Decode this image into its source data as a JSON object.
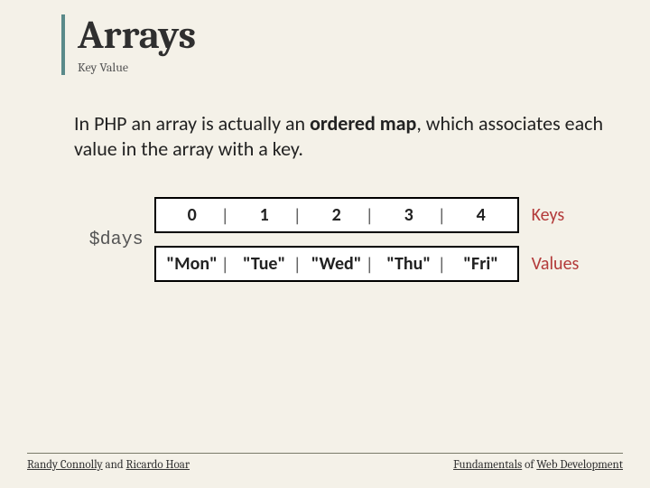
{
  "title": "Arrays",
  "subtitle": "Key Value",
  "body": {
    "pre": "In PHP an array is actually an ",
    "bold": "ordered map",
    "post": ", which associates each value in the array with a key."
  },
  "diagram": {
    "var_name": "$days",
    "keys_label": "Keys",
    "values_label": "Values",
    "keys": [
      "0",
      "1",
      "2",
      "3",
      "4"
    ],
    "values": [
      "\"Mon\"",
      "\"Tue\"",
      "\"Wed\"",
      "\"Thu\"",
      "\"Fri\""
    ]
  },
  "footer": {
    "author1": "Randy Connolly",
    "author_join": " and ",
    "author2": "Ricardo Hoar",
    "book1": "Fundamentals",
    "book_join": " of ",
    "book2": "Web Development"
  }
}
